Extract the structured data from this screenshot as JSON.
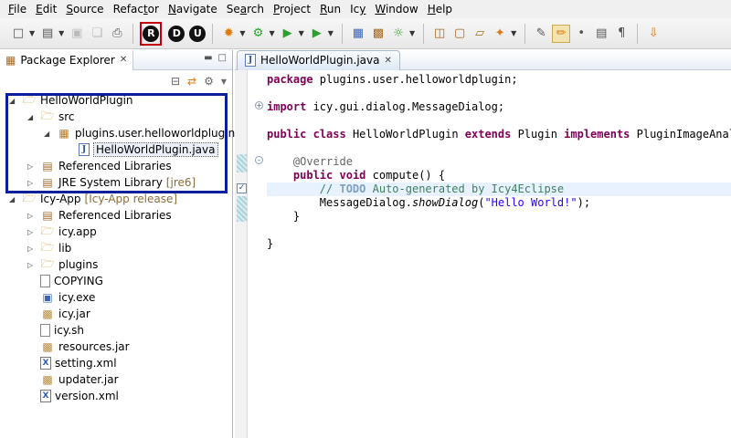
{
  "menubar": {
    "items": [
      {
        "mn": "F",
        "rest": "ile"
      },
      {
        "mn": "E",
        "rest": "dit"
      },
      {
        "mn": "S",
        "rest": "ource"
      },
      {
        "pre": "Refac",
        "mn": "t",
        "rest": "or"
      },
      {
        "mn": "N",
        "rest": "avigate"
      },
      {
        "pre": "Se",
        "mn": "a",
        "rest": "rch"
      },
      {
        "mn": "P",
        "rest": "roject"
      },
      {
        "mn": "R",
        "rest": "un"
      },
      {
        "pre": "Ic",
        "mn": "y",
        "rest": ""
      },
      {
        "mn": "W",
        "rest": "indow"
      },
      {
        "mn": "H",
        "rest": "elp"
      }
    ]
  },
  "toolbar": {
    "r_button": "R",
    "d_button": "D",
    "u_button": "U",
    "accent_highlight": "#c0000a"
  },
  "package_explorer": {
    "tab_label": "Package Explorer",
    "selection_box_color": "#0a1f9c",
    "tree": [
      {
        "label": "HelloWorldPlugin",
        "icon": "project-icon"
      },
      {
        "label": "src",
        "icon": "source-folder-icon"
      },
      {
        "label": "plugins.user.helloworldplugin",
        "icon": "package-icon"
      },
      {
        "label": "HelloWorldPlugin.java",
        "icon": "java-file-icon"
      },
      {
        "label": "Referenced Libraries",
        "icon": "library-icon"
      },
      {
        "label": "JRE System Library",
        "suffix": "[jre6]",
        "icon": "library-icon"
      },
      {
        "label": "Icy-App",
        "suffix": "[Icy-App release]",
        "icon": "project-icon"
      },
      {
        "label": "Referenced Libraries",
        "icon": "library-icon"
      },
      {
        "label": "icy.app",
        "icon": "folder-icon"
      },
      {
        "label": "lib",
        "icon": "folder-icon"
      },
      {
        "label": "plugins",
        "icon": "folder-icon"
      },
      {
        "label": "COPYING",
        "icon": "file-icon"
      },
      {
        "label": "icy.exe",
        "icon": "exe-icon"
      },
      {
        "label": "icy.jar",
        "icon": "jar-icon"
      },
      {
        "label": "icy.sh",
        "icon": "file-icon"
      },
      {
        "label": "resources.jar",
        "icon": "jar-icon"
      },
      {
        "label": "setting.xml",
        "icon": "xml-icon"
      },
      {
        "label": "updater.jar",
        "icon": "jar-icon"
      },
      {
        "label": "version.xml",
        "icon": "xml-icon"
      }
    ]
  },
  "editor": {
    "tab_label": "HelloWorldPlugin.java",
    "code": {
      "l1_kw": "package",
      "l1_rest": " plugins.user.helloworldplugin;",
      "l2_kw": "import",
      "l2_rest": " icy.gui.dialog.MessageDialog;",
      "l3_kw1": "public",
      "l3_kw2": "class",
      "l3_mid": " HelloWorldPlugin ",
      "l3_kw3": "extends",
      "l3_mid2": " Plugin ",
      "l3_kw4": "implements",
      "l3_rest": " PluginImageAnalys",
      "l4_ann": "@Override",
      "l5_kw1": "public",
      "l5_kw2": "void",
      "l5_rest": " compute() {",
      "l6_pre": "// ",
      "l6_todo": "TODO",
      "l6_rest": " Auto-generated by Icy4Eclipse",
      "l7_pre": "MessageDialog.",
      "l7_call": "showDialog",
      "l7_open": "(",
      "l7_str": "\"Hello World!\"",
      "l7_close": ");",
      "l8": "}",
      "l9": "}"
    }
  }
}
